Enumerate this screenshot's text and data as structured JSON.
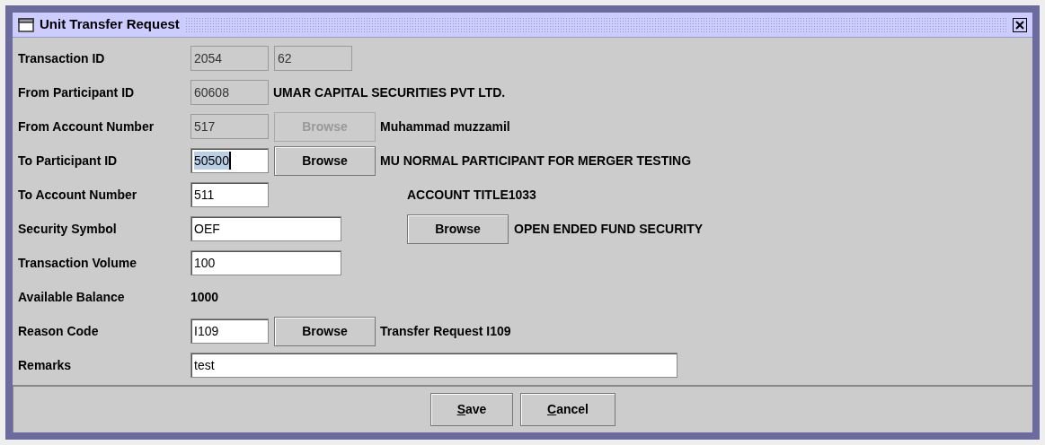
{
  "window": {
    "title": "Unit Transfer Request"
  },
  "rows": [
    {
      "kind": "inline",
      "label": "Transaction ID",
      "inputs": [
        {
          "value": "2054",
          "disabled": true,
          "focused": false,
          "kind": "short"
        },
        {
          "value": "62",
          "disabled": true,
          "focused": false,
          "kind": "short"
        }
      ]
    },
    {
      "kind": "inline",
      "label": "From Participant ID",
      "inputs": [
        {
          "value": "60608",
          "disabled": true,
          "focused": false,
          "kind": "short"
        }
      ],
      "info": "UMAR CAPITAL SECURITIES PVT LTD."
    },
    {
      "kind": "inline",
      "label": "From Account Number",
      "inputs": [
        {
          "value": "517",
          "disabled": true,
          "focused": false,
          "kind": "short"
        }
      ],
      "browse": {
        "label": "Browse",
        "disabled": true
      },
      "info": "Muhammad muzzamil"
    },
    {
      "kind": "inline",
      "label": "To Participant ID",
      "inputs": [
        {
          "value": "50500",
          "disabled": false,
          "focused": true,
          "kind": "short"
        }
      ],
      "browse": {
        "label": "Browse",
        "disabled": false
      },
      "info": "MU NORMAL PARTICIPANT FOR MERGER TESTING"
    },
    {
      "kind": "split",
      "label": "To Account Number",
      "inputs": [
        {
          "value": "511",
          "disabled": false,
          "focused": false,
          "kind": "short"
        }
      ],
      "info": "ACCOUNT TITLE1033"
    },
    {
      "kind": "split",
      "label": "Security Symbol",
      "inputs": [
        {
          "value": "OEF",
          "disabled": false,
          "focused": false,
          "kind": "medium"
        }
      ],
      "browse": {
        "label": "Browse",
        "disabled": false
      },
      "info": "OPEN ENDED FUND SECURITY"
    },
    {
      "kind": "inline",
      "label": "Transaction Volume",
      "inputs": [
        {
          "value": "100",
          "disabled": false,
          "focused": false,
          "kind": "medium"
        }
      ]
    },
    {
      "kind": "value",
      "label": "Available Balance",
      "value": "1000"
    },
    {
      "kind": "inline",
      "label": "Reason Code",
      "inputs": [
        {
          "value": "I109",
          "disabled": false,
          "focused": false,
          "kind": "short"
        }
      ],
      "browse": {
        "label": "Browse",
        "disabled": false
      },
      "info": "Transfer Request I109"
    },
    {
      "kind": "inline",
      "label": "Remarks",
      "inputs": [
        {
          "value": "test",
          "disabled": false,
          "focused": false,
          "kind": "long"
        }
      ]
    }
  ],
  "buttons": [
    {
      "mnemonic": "S",
      "rest": "ave"
    },
    {
      "mnemonic": "C",
      "rest": "ancel"
    }
  ]
}
